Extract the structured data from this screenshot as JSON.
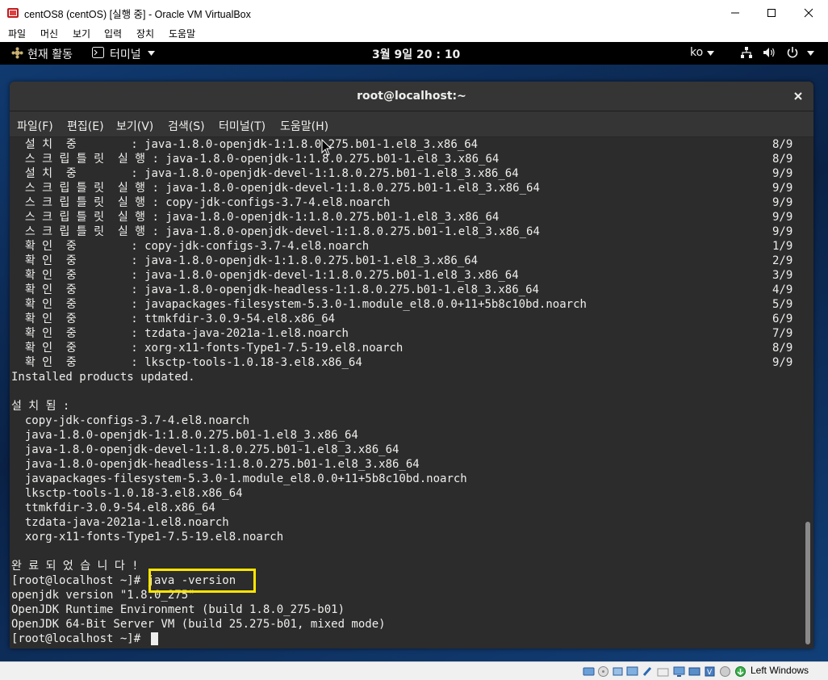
{
  "host": {
    "title": "centOS8 (centOS) [실행 중] - Oracle VM VirtualBox",
    "menu": [
      "파일",
      "머신",
      "보기",
      "입력",
      "장치",
      "도움말"
    ],
    "host_key_label": "Left Windows"
  },
  "gnome": {
    "activities": "현재 활동",
    "app_menu": "터미널",
    "clock": "3월 9일  20 : 10",
    "input_method": "ko"
  },
  "terminal": {
    "title": "root@localhost:~",
    "menu": [
      "파일(F)",
      "편집(E)",
      "보기(V)",
      "검색(S)",
      "터미널(T)",
      "도움말(H)"
    ],
    "lines": [
      "  설 치  중        : java-1.8.0-openjdk-1:1.8.0.275.b01-1.el8_3.x86_64",
      "  스 크 립 틀 릿  실 행 : java-1.8.0-openjdk-1:1.8.0.275.b01-1.el8_3.x86_64",
      "  설 치  중        : java-1.8.0-openjdk-devel-1:1.8.0.275.b01-1.el8_3.x86_64",
      "  스 크 립 틀 릿  실 행 : java-1.8.0-openjdk-devel-1:1.8.0.275.b01-1.el8_3.x86_64",
      "  스 크 립 틀 릿  실 행 : copy-jdk-configs-3.7-4.el8.noarch",
      "  스 크 립 틀 릿  실 행 : java-1.8.0-openjdk-1:1.8.0.275.b01-1.el8_3.x86_64",
      "  스 크 립 틀 릿  실 행 : java-1.8.0-openjdk-devel-1:1.8.0.275.b01-1.el8_3.x86_64",
      "  확 인  중        : copy-jdk-configs-3.7-4.el8.noarch",
      "  확 인  중        : java-1.8.0-openjdk-1:1.8.0.275.b01-1.el8_3.x86_64",
      "  확 인  중        : java-1.8.0-openjdk-devel-1:1.8.0.275.b01-1.el8_3.x86_64",
      "  확 인  중        : java-1.8.0-openjdk-headless-1:1.8.0.275.b01-1.el8_3.x86_64",
      "  확 인  중        : javapackages-filesystem-5.3.0-1.module_el8.0.0+11+5b8c10bd.noarch",
      "  확 인  중        : ttmkfdir-3.0.9-54.el8.x86_64",
      "  확 인  중        : tzdata-java-2021a-1.el8.noarch",
      "  확 인  중        : xorg-x11-fonts-Type1-7.5-19.el8.noarch",
      "  확 인  중        : lksctp-tools-1.0.18-3.el8.x86_64",
      "Installed products updated.",
      "",
      "설 치 됨 :",
      "  copy-jdk-configs-3.7-4.el8.noarch",
      "  java-1.8.0-openjdk-1:1.8.0.275.b01-1.el8_3.x86_64",
      "  java-1.8.0-openjdk-devel-1:1.8.0.275.b01-1.el8_3.x86_64",
      "  java-1.8.0-openjdk-headless-1:1.8.0.275.b01-1.el8_3.x86_64",
      "  javapackages-filesystem-5.3.0-1.module_el8.0.0+11+5b8c10bd.noarch",
      "  lksctp-tools-1.0.18-3.el8.x86_64",
      "  ttmkfdir-3.0.9-54.el8.x86_64",
      "  tzdata-java-2021a-1.el8.noarch",
      "  xorg-x11-fonts-Type1-7.5-19.el8.noarch",
      "",
      "완 료 되 었 습 니 다 !",
      "[root@localhost ~]# java -version",
      "openjdk version \"1.8.0_275\"",
      "OpenJDK Runtime Environment (build 1.8.0_275-b01)",
      "OpenJDK 64-Bit Server VM (build 25.275-b01, mixed mode)",
      "[root@localhost ~]# "
    ],
    "counters": [
      "8/9",
      "8/9",
      "9/9",
      "9/9",
      "9/9",
      "9/9",
      "9/9",
      "1/9",
      "2/9",
      "3/9",
      "4/9",
      "5/9",
      "6/9",
      "7/9",
      "8/9",
      "9/9"
    ],
    "highlight_color": "#ffe500"
  }
}
